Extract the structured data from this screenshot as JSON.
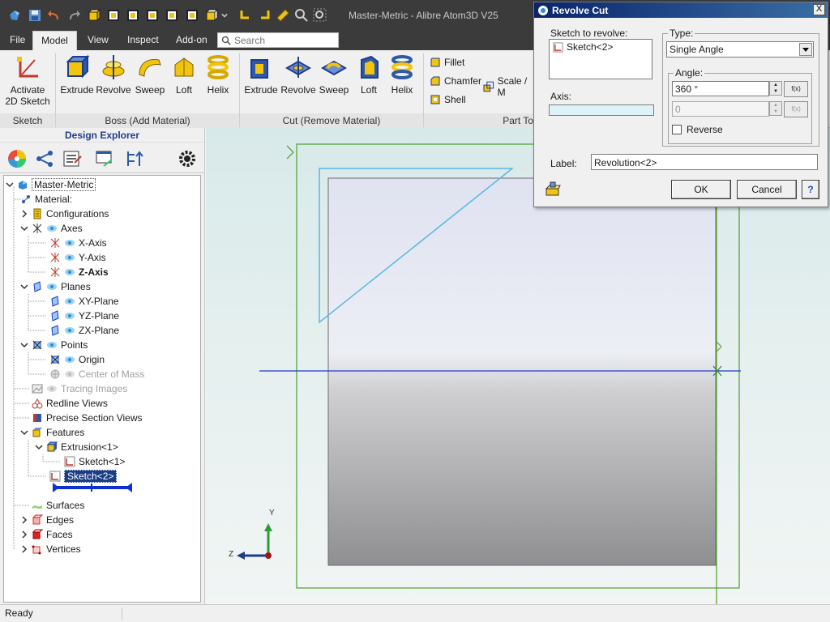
{
  "app": {
    "title": "Master-Metric - Alibre Atom3D V25"
  },
  "menu": {
    "tabs": [
      "File",
      "Model",
      "View",
      "Inspect",
      "Add-on"
    ],
    "active": "Model",
    "search_placeholder": "Search"
  },
  "ribbon": {
    "sketch_group": {
      "label": "Sketch",
      "button": "Activate 2D Sketch",
      "button_line1": "Activate",
      "button_line2": "2D Sketch"
    },
    "boss_group": {
      "label": "Boss (Add Material)",
      "buttons": [
        "Extrude",
        "Revolve",
        "Sweep",
        "Loft",
        "Helix"
      ]
    },
    "cut_group": {
      "label": "Cut (Remove Material)",
      "buttons": [
        "Extrude",
        "Revolve",
        "Sweep",
        "Loft",
        "Helix"
      ]
    },
    "part_group": {
      "label": "Part To",
      "small_buttons": [
        "Fillet",
        "Chamfer",
        "Scale / M",
        "Shell"
      ]
    }
  },
  "explorer": {
    "title": "Design Explorer",
    "tree": {
      "root": "Master-Metric",
      "material": "Material:",
      "configurations": "Configurations",
      "axes": "Axes",
      "x_axis": "X-Axis",
      "y_axis": "Y-Axis",
      "z_axis": "Z-Axis",
      "planes": "Planes",
      "xy_plane": "XY-Plane",
      "yz_plane": "YZ-Plane",
      "zx_plane": "ZX-Plane",
      "points": "Points",
      "origin": "Origin",
      "center_of_mass": "Center of Mass",
      "tracing_images": "Tracing Images",
      "redline_views": "Redline Views",
      "precise_section_views": "Precise Section Views",
      "features": "Features",
      "extrusion": "Extrusion<1>",
      "sketch1": "Sketch<1>",
      "sketch2": "Sketch<2>",
      "surfaces": "Surfaces",
      "edges": "Edges",
      "faces": "Faces",
      "vertices": "Vertices"
    }
  },
  "viewport": {
    "triad": {
      "y": "Y",
      "z": "Z"
    }
  },
  "status": {
    "text": "Ready"
  },
  "dialog": {
    "title": "Revolve Cut",
    "sketch_label": "Sketch to revolve:",
    "sketch_item": "Sketch<2>",
    "axis_label": "Axis:",
    "type_label": "Type:",
    "type_value": "Single Angle",
    "angle_label": "Angle:",
    "angle_value": "360 °",
    "angle2_value": "0",
    "fx_label": "f(x)",
    "reverse_label": "Reverse",
    "label_label": "Label:",
    "label_value": "Revolution<2>",
    "ok": "OK",
    "cancel": "Cancel",
    "help": "?",
    "close": "X"
  },
  "colors": {
    "titlebar": "#3b3b3b",
    "accent_yellow": "#f2c40f",
    "selection": "#1b3d86",
    "sketch_green": "#5aa53a",
    "sketch_cyan": "#5ab7e0",
    "axis_blue": "#1f3bc7"
  }
}
